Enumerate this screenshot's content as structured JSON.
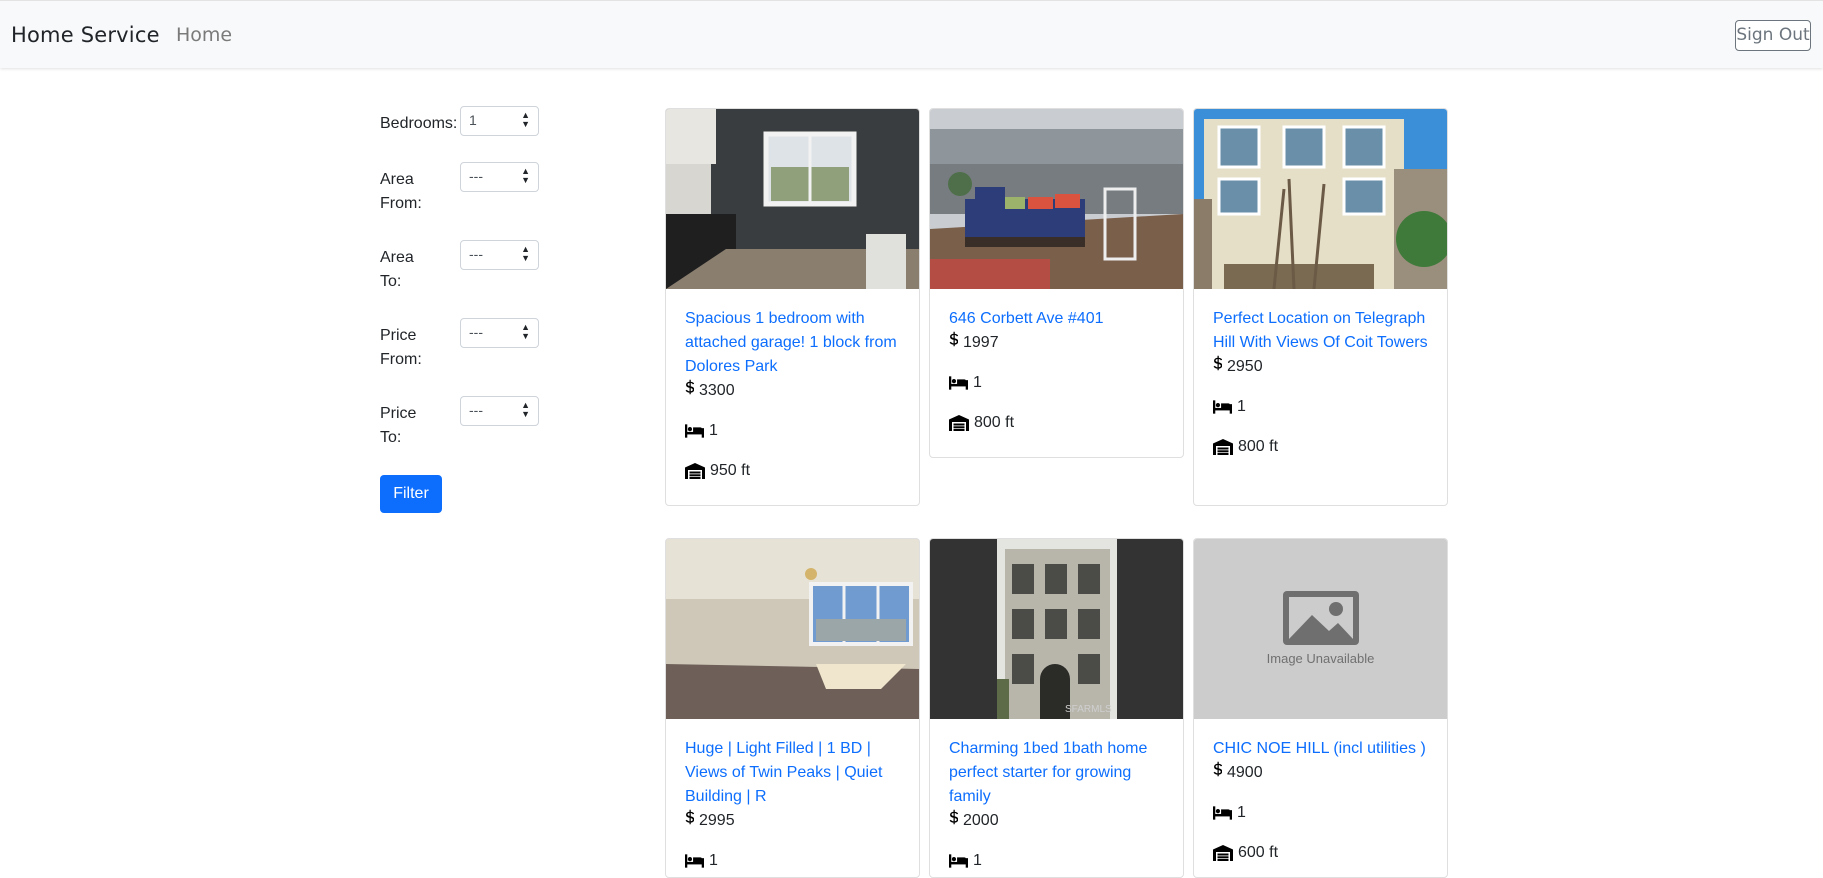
{
  "navbar": {
    "brand": "Home Service",
    "home_link": "Home",
    "signout": "Sign Out"
  },
  "filters": {
    "bedrooms_label": "Bedrooms:",
    "bedrooms_value": "1",
    "area_from_label_1": "Area",
    "area_from_label_2": "From:",
    "area_from_value": "---",
    "area_to_label_1": "Area",
    "area_to_label_2": "To:",
    "area_to_value": "---",
    "price_from_label_1": "Price",
    "price_from_label_2": "From:",
    "price_from_value": "---",
    "price_to_label_1": "Price",
    "price_to_label_2": "To:",
    "price_to_value": "---",
    "filter_button": "Filter"
  },
  "listings": [
    {
      "title": "Spacious 1 bedroom with attached garage! 1 block from Dolores Park",
      "price": "3300",
      "bedrooms": "1",
      "area": "950 ft"
    },
    {
      "title": "646 Corbett Ave #401",
      "price": "1997",
      "bedrooms": "1",
      "area": "800 ft"
    },
    {
      "title": "Perfect Location on Telegraph Hill With Views Of Coit Towers",
      "price": "2950",
      "bedrooms": "1",
      "area": "800 ft"
    },
    {
      "title": "Huge | Light Filled | 1 BD | Views of Twin Peaks | Quiet Building | R",
      "price": "2995",
      "bedrooms": "1",
      "area": ""
    },
    {
      "title": "Charming 1bed 1bath home perfect starter for growing family",
      "price": "2000",
      "bedrooms": "1",
      "area": ""
    },
    {
      "title": "CHIC NOE HILL (incl utilities )",
      "price": "4900",
      "bedrooms": "1",
      "area": "600 ft",
      "image_text": "Image Unavailable"
    }
  ],
  "photo_watermark": "SFARMLS"
}
